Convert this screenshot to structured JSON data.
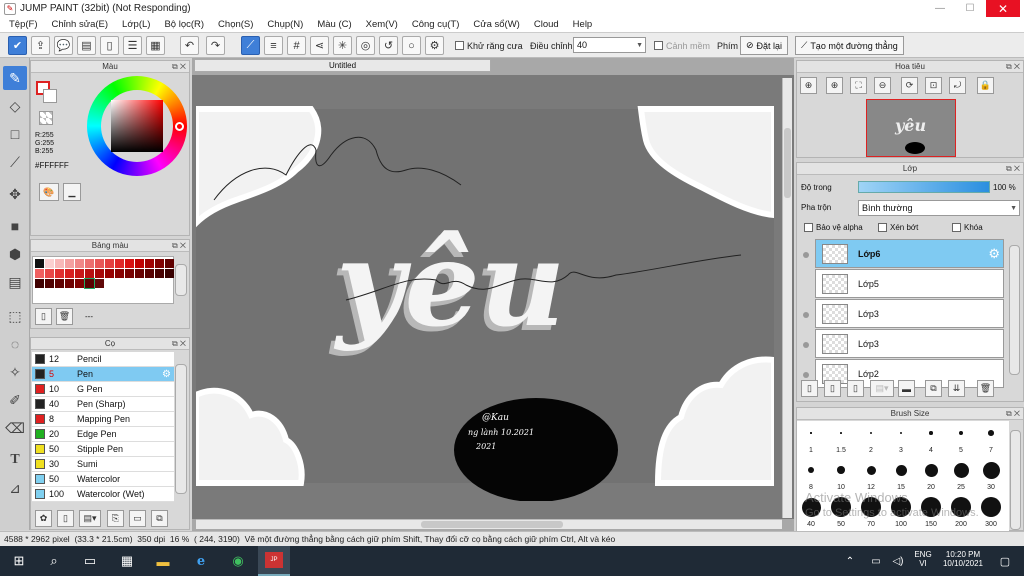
{
  "window": {
    "title": "JUMP PAINT (32bit) (Not Responding)",
    "close": "✕",
    "maximize": "☐",
    "minimize": "—"
  },
  "menu": [
    "Tệp(F)",
    "Chỉnh sửa(E)",
    "Lớp(L)",
    "Bộ lọc(R)",
    "Chọn(S)",
    "Chụp(N)",
    "Màu (C)",
    "Xem(V)",
    "Công cụ(T)",
    "Cửa sổ(W)",
    "Cloud",
    "Help"
  ],
  "toolbar": {
    "antialias_label": "Khử răng cưa",
    "adjust_label": "Điều chỉnh",
    "adjust_value": "40",
    "warning_label": "Cảnh mềm",
    "key_label": "Phím",
    "reset_label": "Đặt lại",
    "create_line_label": "Tạo một đường thẳng"
  },
  "color_panel": {
    "title": "Màu",
    "rgb_r": "R:255",
    "rgb_g": "G:255",
    "rgb_b": "B:255",
    "hex": "#FFFFFF"
  },
  "palette_panel": {
    "title": "Bảng màu",
    "footer_text": "---"
  },
  "brush_panel": {
    "title": "Cọ",
    "brushes": [
      {
        "size": "12",
        "name": "Pencil",
        "color": "#222222"
      },
      {
        "size": "5",
        "name": "Pen",
        "color": "#222222"
      },
      {
        "size": "10",
        "name": "G Pen",
        "color": "#e02020"
      },
      {
        "size": "40",
        "name": "Pen (Sharp)",
        "color": "#222222"
      },
      {
        "size": "8",
        "name": "Mapping Pen",
        "color": "#e02020"
      },
      {
        "size": "20",
        "name": "Edge Pen",
        "color": "#20b020"
      },
      {
        "size": "50",
        "name": "Stipple Pen",
        "color": "#f0e020"
      },
      {
        "size": "30",
        "name": "Sumi",
        "color": "#f0e020"
      },
      {
        "size": "50",
        "name": "Watercolor",
        "color": "#80d0f0"
      },
      {
        "size": "100",
        "name": "Watercolor (Wet)",
        "color": "#80d0f0"
      }
    ]
  },
  "canvas": {
    "tab_title": "Untitled",
    "word": "yêu"
  },
  "navigator": {
    "title": "Hoa tiêu"
  },
  "layer_panel": {
    "title": "Lớp",
    "opacity_label": "Độ trong",
    "opacity_value": "100 %",
    "blend_label": "Pha trộn",
    "blend_value": "Bình thường",
    "protect_alpha_label": "Bảo vệ alpha",
    "clip_label": "Xén bớt",
    "lock_label": "Khóa",
    "layers": [
      "Lớp6",
      "Lớp5",
      "Lớp3",
      "Lớp3",
      "Lớp2"
    ]
  },
  "brush_size_panel": {
    "title": "Brush Size",
    "sizes": [
      "1",
      "1.5",
      "2",
      "3",
      "4",
      "5",
      "7",
      "8",
      "10",
      "12",
      "15",
      "20",
      "25",
      "30",
      "40",
      "50",
      "70",
      "100",
      "150",
      "200",
      "300",
      "400"
    ],
    "watermark_1": "Activate Windows",
    "watermark_2": "Go to Settings to activate Windows."
  },
  "status": {
    "dims": "4588 * 2962 pixel",
    "cm": "(33.3 * 21.5cm)",
    "dpi": "350 dpi",
    "zoom": "16 %",
    "coords": "( 244, 3190)",
    "hint": "Vẽ một đường thẳng bằng cách giữ phím Shift, Thay đổi cỡ cọ bằng cách giữ phím Ctrl, Alt và kéo"
  },
  "taskbar": {
    "lang1": "ENG",
    "lang2": "VI",
    "time": "10:20 PM",
    "date": "10/10/2021"
  }
}
